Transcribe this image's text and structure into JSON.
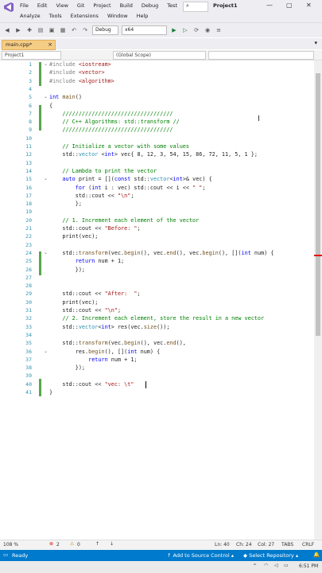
{
  "menu_row1": [
    "File",
    "Edit",
    "View",
    "Git",
    "Project",
    "Build",
    "Debug",
    "Test"
  ],
  "menu_row2": [
    "Analyze",
    "Tools",
    "Extensions",
    "Window",
    "Help"
  ],
  "project_title": "Project1",
  "toolbar": {
    "config": "Debug",
    "platform": "x64"
  },
  "tab": {
    "label": "main.cpp*",
    "pin": "⊼",
    "close": "×"
  },
  "nav": {
    "project": "Project1",
    "scope": "(Global Scope)"
  },
  "code": [
    {
      "n": "1",
      "html": "<span class='pp'>#include</span> <span class='str'>&lt;iostream&gt;</span>"
    },
    {
      "n": "2",
      "html": "<span class='pp'>#include</span> <span class='str'>&lt;vector&gt;</span>"
    },
    {
      "n": "3",
      "html": "<span class='pp'>#include</span> <span class='str'>&lt;algorithm&gt;</span>"
    },
    {
      "n": "4",
      "html": ""
    },
    {
      "n": "5",
      "html": "<span class='kw'>int</span> <span class='fn'>main</span>()"
    },
    {
      "n": "6",
      "html": "{"
    },
    {
      "n": "7",
      "html": "    <span class='cm'>//////////////////////////////////</span>"
    },
    {
      "n": "8",
      "html": "    <span class='cm'>// C++ Algorithms: std::transform //</span>"
    },
    {
      "n": "9",
      "html": "    <span class='cm'>//////////////////////////////////</span>"
    },
    {
      "n": "10",
      "html": ""
    },
    {
      "n": "11",
      "html": "    <span class='cm'>// Initialize a vector with some values</span>"
    },
    {
      "n": "12",
      "html": "    std::<span class='ty'>vector</span> &lt;<span class='kw'>int</span>&gt; vec{ 8, 12, 3, 54, 15, 86, 72, 11, 5, 1 };"
    },
    {
      "n": "13",
      "html": ""
    },
    {
      "n": "14",
      "html": "    <span class='cm'>// Lambda to print the vector</span>"
    },
    {
      "n": "15",
      "html": "    <span class='kw'>auto</span> print = [](<span class='kw'>const</span> std::<span class='ty'>vector</span>&lt;<span class='kw'>int</span>&gt;&amp; vec) {"
    },
    {
      "n": "16",
      "html": "        <span class='kw'>for</span> (<span class='kw'>int</span> i : vec) std::cout &lt;&lt; i &lt;&lt; <span class='str'>\" \"</span>;"
    },
    {
      "n": "17",
      "html": "        std::cout &lt;&lt; <span class='str'>\"\\n\"</span>;"
    },
    {
      "n": "18",
      "html": "        };"
    },
    {
      "n": "19",
      "html": ""
    },
    {
      "n": "20",
      "html": "    <span class='cm'>// 1. Increment each element of the vector</span>"
    },
    {
      "n": "21",
      "html": "    std::cout &lt;&lt; <span class='str'>\"Before: \"</span>;"
    },
    {
      "n": "22",
      "html": "    print(vec);"
    },
    {
      "n": "23",
      "html": ""
    },
    {
      "n": "24",
      "html": "    std::<span class='fn'>transform</span>(vec.<span class='fn'>begin</span>(), vec.<span class='fn'>end</span>(), vec.<span class='fn'>begin</span>(), [](<span class='kw'>int</span> num) {"
    },
    {
      "n": "25",
      "html": "        <span class='kw'>return</span> num + 1;"
    },
    {
      "n": "26",
      "html": "        });"
    },
    {
      "n": "27",
      "html": ""
    },
    {
      "n": "28",
      "html": ""
    },
    {
      "n": "29",
      "html": "    std::cout &lt;&lt; <span class='str'>\"After:  \"</span>;"
    },
    {
      "n": "30",
      "html": "    print(vec);"
    },
    {
      "n": "31",
      "html": "    std::cout &lt;&lt; <span class='str'>\"\\n\"</span>;"
    },
    {
      "n": "32",
      "html": "    <span class='cm'>// 2. Increment each element, store the result in a new vector</span>"
    },
    {
      "n": "33",
      "html": "    std::<span class='ty'>vector</span>&lt;<span class='kw'>int</span>&gt; res(vec.<span class='fn'>size</span>());"
    },
    {
      "n": "34",
      "html": ""
    },
    {
      "n": "35",
      "html": "    std::<span class='fn'>transform</span>(vec.<span class='fn'>begin</span>(), vec.<span class='fn'>end</span>(),"
    },
    {
      "n": "36",
      "html": "        res.<span class='fn'>begin</span>(), [](<span class='kw'>int</span> num) {"
    },
    {
      "n": "37",
      "html": "            <span class='kw'>return</span> num + 1;"
    },
    {
      "n": "38",
      "html": "        });"
    },
    {
      "n": "39",
      "html": ""
    },
    {
      "n": "40",
      "html": "    std::cout &lt;&lt; <span class='str'>\"vec: \\t\"</span>"
    },
    {
      "n": "41",
      "html": "}"
    }
  ],
  "status_row": {
    "zoom": "108 %",
    "errors": "2",
    "warnings": "0",
    "ln": "Ln: 40",
    "ch": "Ch: 24",
    "col": "Col: 27",
    "tabs": "TABS",
    "crlf": "CRLF"
  },
  "statusbar": {
    "ready": "Ready",
    "source_control": "Add to Source Control",
    "repo": "Select Repository"
  },
  "taskbar": {
    "time": "6:51 PM"
  },
  "colors": {
    "accent": "#007acc",
    "tab": "#f5cc84",
    "change": "#57a64a"
  }
}
